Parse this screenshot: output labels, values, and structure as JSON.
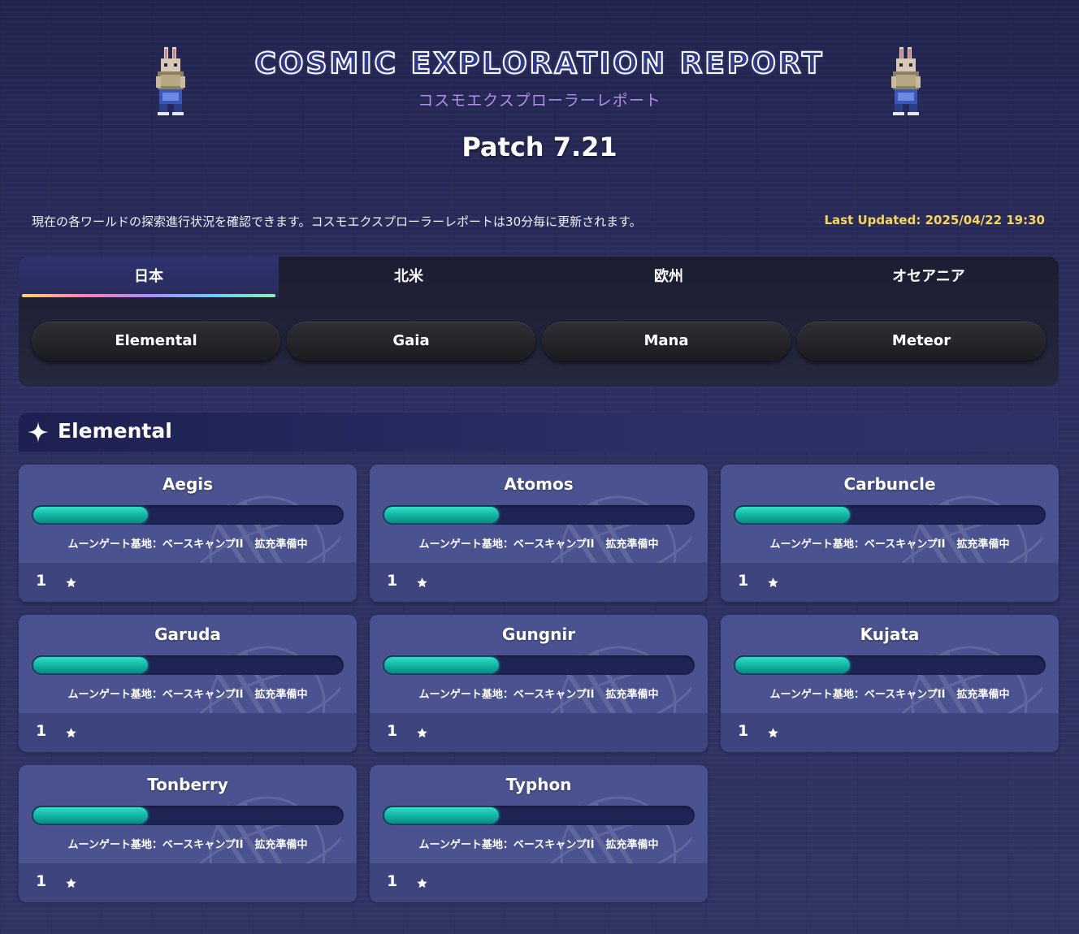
{
  "header": {
    "title": "COSMIC EXPLORATION REPORT",
    "subtitle": "コスモエクスプローラーレポート",
    "patch": "Patch 7.21"
  },
  "info": {
    "description": "現在の各ワールドの探索進行状況を確認できます。コスモエクスプローラーレポートは30分毎に更新されます。",
    "last_updated": "Last Updated: 2025/04/22 19:30"
  },
  "regions": {
    "tabs": [
      {
        "label": "日本",
        "active": true
      },
      {
        "label": "北米",
        "active": false
      },
      {
        "label": "欧州",
        "active": false
      },
      {
        "label": "オセアニア",
        "active": false
      }
    ]
  },
  "data_centers": [
    {
      "label": "Elemental"
    },
    {
      "label": "Gaia"
    },
    {
      "label": "Mana"
    },
    {
      "label": "Meteor"
    }
  ],
  "section": {
    "title": "Elemental",
    "icon": "sparkle-icon"
  },
  "worlds": [
    {
      "name": "Aegis",
      "progress": 0.37,
      "location": "ムーンゲート基地：ベースキャンプII",
      "status": "拡充準備中",
      "level": "1"
    },
    {
      "name": "Atomos",
      "progress": 0.37,
      "location": "ムーンゲート基地：ベースキャンプII",
      "status": "拡充準備中",
      "level": "1"
    },
    {
      "name": "Carbuncle",
      "progress": 0.37,
      "location": "ムーンゲート基地：ベースキャンプII",
      "status": "拡充準備中",
      "level": "1"
    },
    {
      "name": "Garuda",
      "progress": 0.37,
      "location": "ムーンゲート基地：ベースキャンプII",
      "status": "拡充準備中",
      "level": "1"
    },
    {
      "name": "Gungnir",
      "progress": 0.37,
      "location": "ムーンゲート基地：ベースキャンプII",
      "status": "拡充準備中",
      "level": "1"
    },
    {
      "name": "Kujata",
      "progress": 0.37,
      "location": "ムーンゲート基地：ベースキャンプII",
      "status": "拡充準備中",
      "level": "1"
    },
    {
      "name": "Tonberry",
      "progress": 0.37,
      "location": "ムーンゲート基地：ベースキャンプII",
      "status": "拡充準備中",
      "level": "1"
    },
    {
      "name": "Typhon",
      "progress": 0.37,
      "location": "ムーンゲート基地：ベースキャンプII",
      "status": "拡充準備中",
      "level": "1"
    }
  ],
  "colors": {
    "accent_yellow": "#f5d65a",
    "progress_teal": "#10b3a0",
    "card_bg": "#4a5290",
    "subtitle_purple": "#b08ee8"
  }
}
